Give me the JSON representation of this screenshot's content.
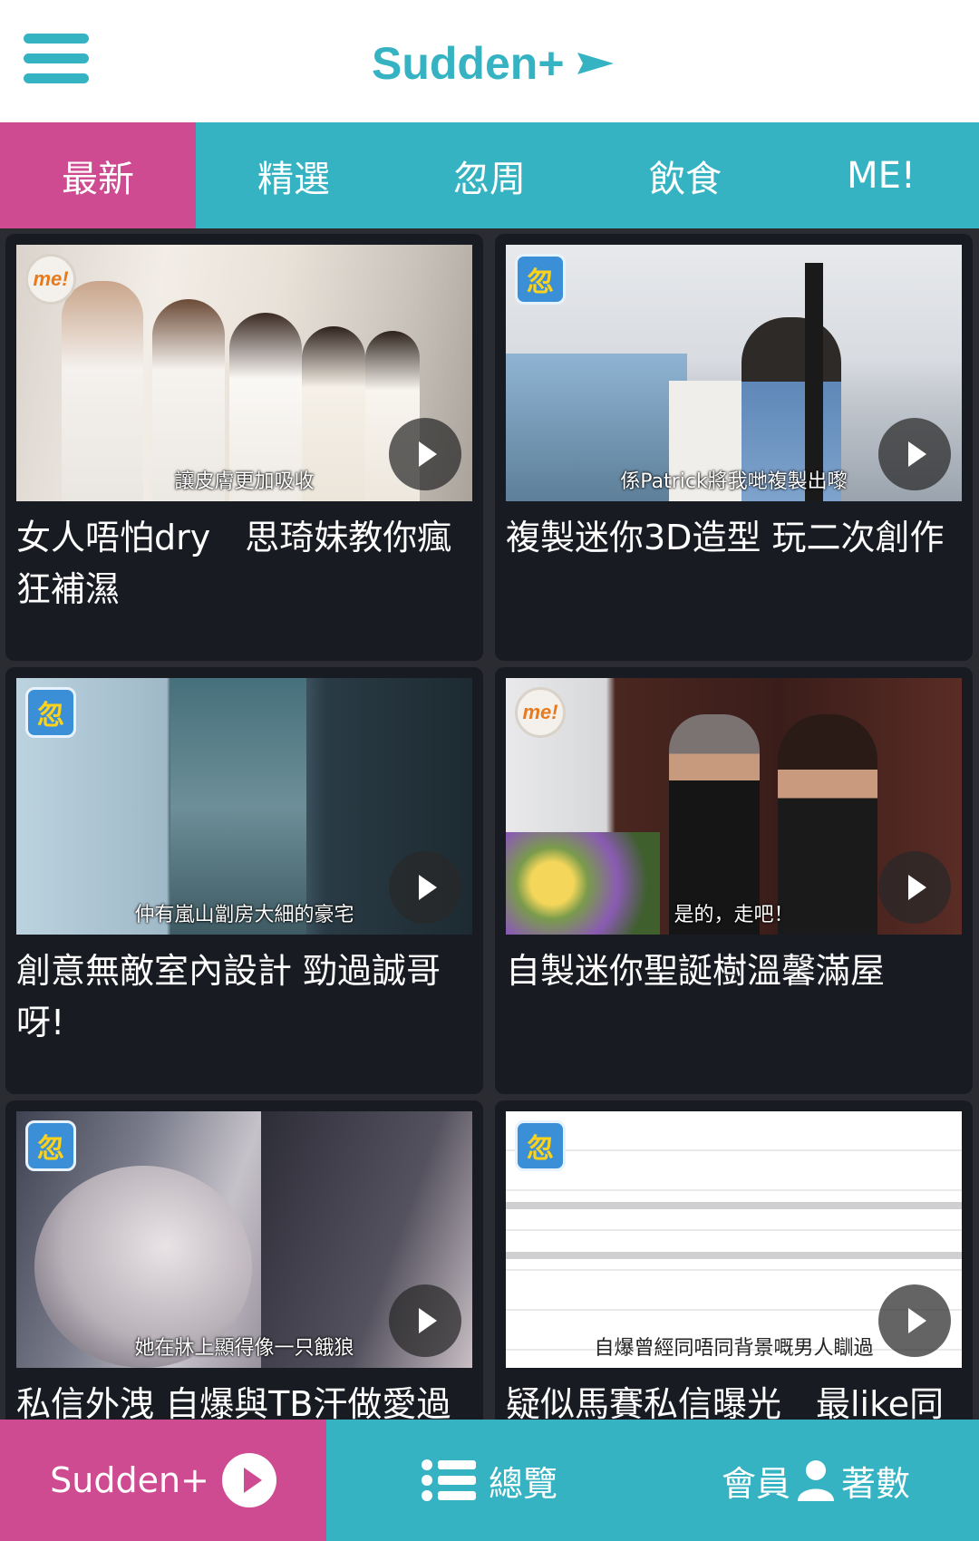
{
  "header": {
    "brand": "Sudden+"
  },
  "tabs": [
    {
      "label": "最新",
      "active": true
    },
    {
      "label": "精選",
      "active": false
    },
    {
      "label": "忽周",
      "active": false
    },
    {
      "label": "飲食",
      "active": false
    },
    {
      "label": "ME!",
      "active": false
    }
  ],
  "cards": [
    {
      "title": "女人唔怕dry　思琦妹教你瘋狂補濕",
      "caption": "讓皮膚更加吸收",
      "logo": "me!",
      "logo_style": "me"
    },
    {
      "title": "複製迷你3D造型 玩二次創作",
      "caption": "係Patrick將我哋複製出嚟",
      "logo": "忽",
      "logo_style": "sudden"
    },
    {
      "title": "創意無敵室內設計 勁過誠哥呀!",
      "caption": "仲有嵐山劏房大細的豪宅",
      "logo": "忽",
      "logo_style": "sudden"
    },
    {
      "title": "自製迷你聖誕樹溫馨滿屋",
      "caption": "是的，走吧！",
      "logo": "me!",
      "logo_style": "me"
    },
    {
      "title": "私信外洩 自爆與TB汗做愛過",
      "caption": "她在牀上顯得像一只餓狼",
      "logo": "忽",
      "logo_style": "sudden"
    },
    {
      "title": "疑似馬賽私信曝光　最like同",
      "caption": "自爆曾經同唔同背景嘅男人瞓過",
      "logo": "忽",
      "logo_style": "sudden"
    }
  ],
  "bottom_nav": {
    "sudden_label": "Sudden+",
    "browse_label": "總覽",
    "member_label_left": "會員",
    "member_label_right": "著數"
  },
  "colors": {
    "accent_teal": "#36b3c2",
    "accent_pink": "#cf4b91",
    "card_bg": "#181b22",
    "feed_bg": "#2a2c31"
  },
  "icons": {
    "menu": "hamburger-icon",
    "brand_arrow": "arrow-right-icon",
    "play": "play-icon",
    "list": "list-icon",
    "user": "user-icon"
  }
}
